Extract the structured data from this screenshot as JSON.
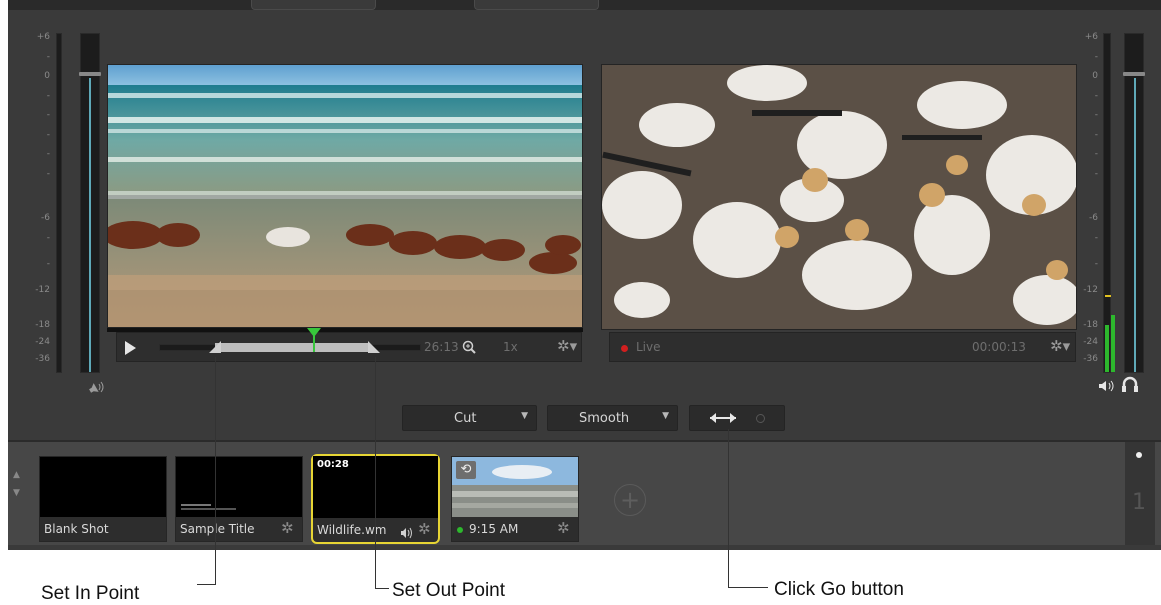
{
  "meters": {
    "left_ticks": [
      "+6",
      "-",
      "0",
      "-",
      "-",
      "-",
      "-",
      "-",
      "-6",
      "-",
      "-",
      "-12",
      "-18",
      "-24",
      "-36"
    ],
    "right_ticks": [
      "+6",
      "-",
      "0",
      "-",
      "-",
      "-",
      "-",
      "-",
      "-6",
      "-",
      "-",
      "-12",
      "-18",
      "-24",
      "-36"
    ]
  },
  "preview": {
    "timecode": "26:13",
    "speed": "1x"
  },
  "program": {
    "live_label": "Live",
    "timecode": "00:00:13"
  },
  "transitions": {
    "cut_label": "Cut",
    "smooth_label": "Smooth"
  },
  "shots": [
    {
      "label": "Blank Shot"
    },
    {
      "label": "Sample Title"
    },
    {
      "label": "Wildlife.wm",
      "duration": "00:28"
    },
    {
      "label": "9:15 AM"
    }
  ],
  "bin": {
    "layer_number": "1"
  },
  "annotations": {
    "set_in": "Set In Point",
    "set_out": "Set Out Point",
    "click_go": "Click Go button"
  },
  "colors": {
    "accent_yellow": "#e7d534",
    "live_red": "#d11f1f",
    "meter_blue": "#5fa9b8",
    "meter_green": "#2db82d"
  }
}
